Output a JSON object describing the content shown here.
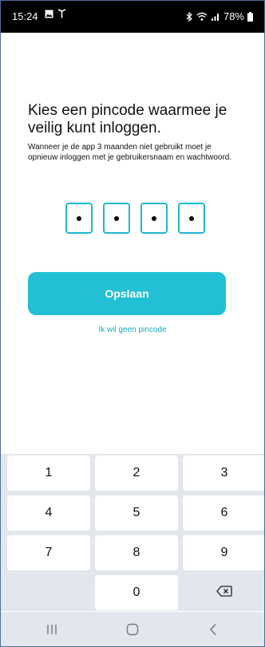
{
  "status_bar": {
    "time": "15:24",
    "battery": "78%",
    "left_icons": [
      "gallery-icon",
      "antenna-icon"
    ],
    "right_icons": [
      "bluetooth-icon",
      "wifi-icon",
      "signal-icon",
      "battery-icon"
    ]
  },
  "screen": {
    "title": "Kies een pincode waarmee je veilig kunt inloggen.",
    "subtitle": "Wanneer je de app 3 maanden niet gebruikt moet je opnieuw inloggen met je gebruikersnaam en wachtwoord.",
    "pin_digits_filled": 4,
    "pin_length": 4,
    "save_label": "Opslaan",
    "no_pin_link": "Ik wil geen pincode"
  },
  "keypad": {
    "keys": [
      "1",
      "2",
      "3",
      "4",
      "5",
      "6",
      "7",
      "8",
      "9",
      "",
      "0",
      "backspace-icon"
    ]
  },
  "nav_bar": {
    "buttons": [
      "recent-apps-icon",
      "home-icon",
      "back-icon"
    ]
  },
  "colors": {
    "accent": "#21c0d4",
    "link": "#1aa9be",
    "keypad_bg": "#e3e6ec"
  }
}
